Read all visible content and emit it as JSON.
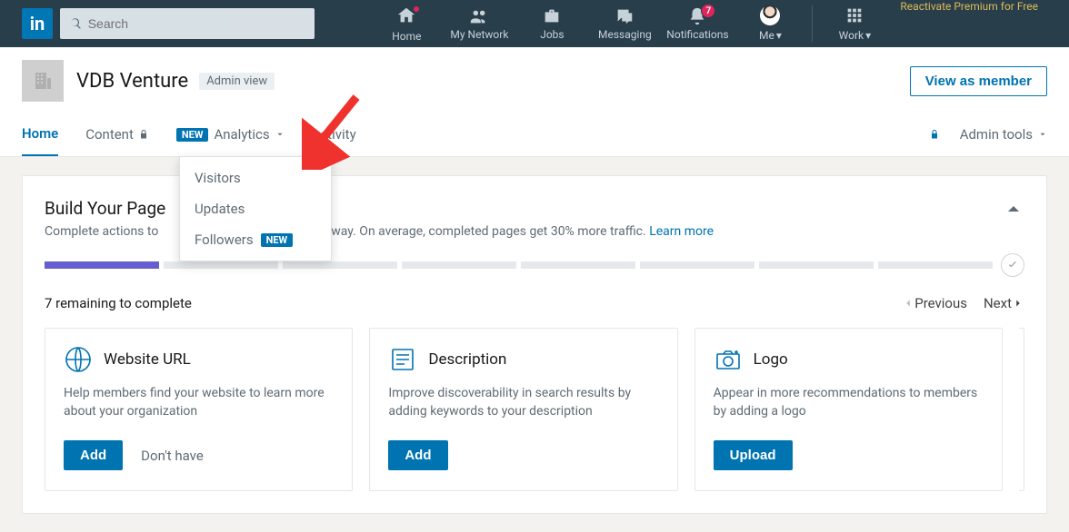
{
  "top": {
    "logo": "in",
    "search_placeholder": "Search",
    "nav": {
      "home": "Home",
      "network": "My Network",
      "jobs": "Jobs",
      "messaging": "Messaging",
      "notifications": "Notifications",
      "notifications_count": "7",
      "me": "Me",
      "work": "Work",
      "premium": "Reactivate Premium for Free"
    }
  },
  "page": {
    "title": "VDB Venture",
    "admin_view": "Admin view",
    "view_member": "View as member"
  },
  "tabs": {
    "home": "Home",
    "content": "Content",
    "new_badge": "NEW",
    "analytics": "Analytics",
    "activity": "Activity",
    "admin_tools": "Admin tools"
  },
  "dropdown": {
    "visitors": "Visitors",
    "updates": "Updates",
    "followers": "Followers",
    "followers_badge": "NEW"
  },
  "build": {
    "heading": "Build Your Page",
    "subtext": "Complete actions to",
    "subtext_tail": "the way. On average, completed pages get 30% more traffic.",
    "learn_more": "Learn more",
    "remaining": "7 remaining to complete",
    "prev": "Previous",
    "next": "Next"
  },
  "cards": [
    {
      "title": "Website URL",
      "desc": "Help members find your website to learn more about your organization",
      "primary": "Add",
      "secondary": "Don't have"
    },
    {
      "title": "Description",
      "desc": "Improve discoverability in search results by adding keywords to your description",
      "primary": "Add"
    },
    {
      "title": "Logo",
      "desc": "Appear in more recommendations to members by adding a logo",
      "primary": "Upload"
    }
  ]
}
